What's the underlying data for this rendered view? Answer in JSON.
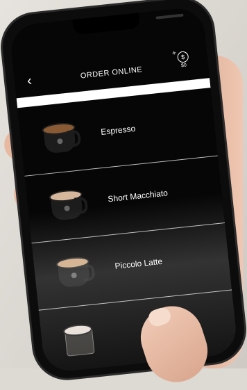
{
  "header": {
    "title": "ORDER ONLINE",
    "back_icon": "chevron-left-icon",
    "cart_icon": "dollar-cart-icon",
    "cart_amount": "$0"
  },
  "menu": {
    "items": [
      {
        "label": "Espresso",
        "icon": "espresso-cup-icon"
      },
      {
        "label": "Short Macchiato",
        "icon": "macchiato-cup-icon"
      },
      {
        "label": "Piccolo Latte",
        "icon": "latte-cup-icon"
      },
      {
        "label": "",
        "icon": "glass-cup-icon"
      }
    ]
  },
  "colors": {
    "screen_bg": "#060606",
    "text": "#ffffff",
    "divider": "#bdbdbd"
  }
}
